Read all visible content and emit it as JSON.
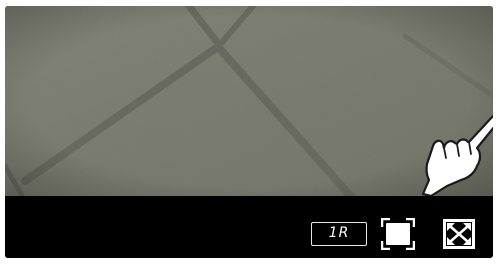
{
  "player": {
    "controls": {
      "playback_rate_label": "1R",
      "icons": {
        "fit": "fit-screen-icon",
        "fullscreen": "fullscreen-icon"
      }
    },
    "cursor": "hand-pointer-icon"
  },
  "colors": {
    "control_bar": "#000000",
    "icon_color": "#ffffff"
  }
}
